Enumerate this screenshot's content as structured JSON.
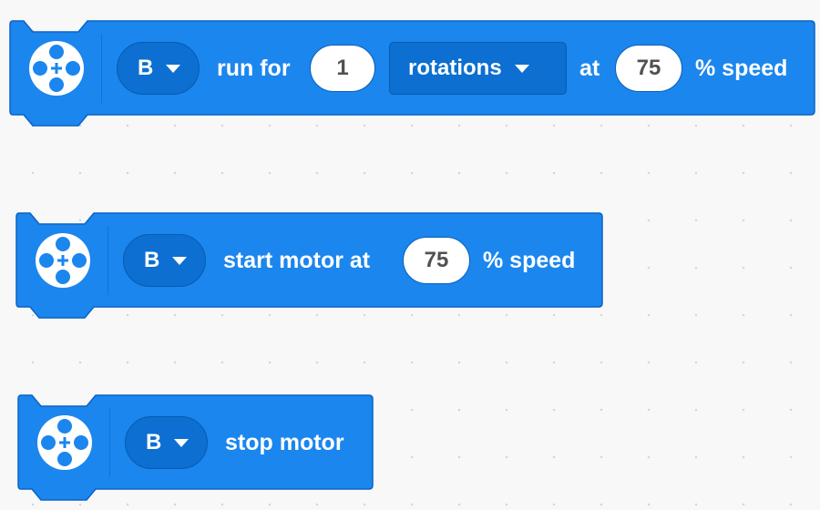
{
  "colors": {
    "block": "#1b86ee",
    "block_border": "#0a63c4",
    "dropdown": "#0c6fd1",
    "canvas": "#f8f8f8"
  },
  "blocks": [
    {
      "name": "run-for-block",
      "icon": "motor-icon",
      "port": "B",
      "label_1": "run for",
      "amount": "1",
      "unit": "rotations",
      "label_2": "at",
      "speed": "75",
      "label_3": "% speed"
    },
    {
      "name": "start-motor-block",
      "icon": "motor-icon",
      "port": "B",
      "label_1": "start motor at",
      "speed": "75",
      "label_2": "% speed"
    },
    {
      "name": "stop-motor-block",
      "icon": "motor-icon",
      "port": "B",
      "label_1": "stop motor"
    }
  ]
}
